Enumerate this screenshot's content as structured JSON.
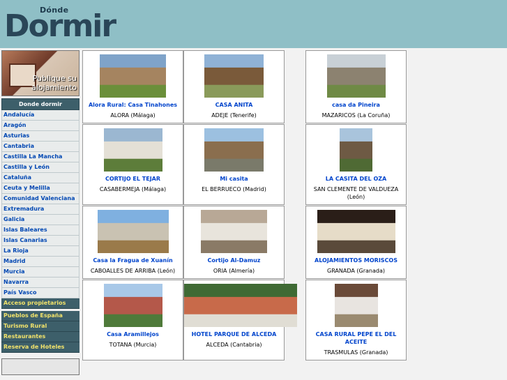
{
  "header": {
    "logo_small": "Dónde",
    "logo_big": "Dormir"
  },
  "sidebar": {
    "promo_text": "Publique su alojamiento",
    "nav_title": "Donde dormir",
    "regions": [
      "Andalucía",
      "Aragón",
      "Asturias",
      "Cantabria",
      "Castilla La Mancha",
      "Castilla y León",
      "Cataluña",
      "Ceuta y Melilla",
      "Comunidad Valenciana",
      "Extremadura",
      "Galicia",
      "Islas Baleares",
      "Islas Canarias",
      "La Rioja",
      "Madrid",
      "Murcia",
      "Navarra",
      "País Vasco"
    ],
    "owner_access": "Acceso propietarios",
    "extra_links": [
      "Pueblos de España",
      "Turismo Rural",
      "Restaurantes",
      "Reserva de Hoteles"
    ]
  },
  "listings": [
    {
      "name": "Alora Rural: Casa Tinahones",
      "location": "ALORA (Málaga)",
      "colors": [
        "#7fa3c9",
        "#a58460",
        "#6b8f3a"
      ]
    },
    {
      "name": "CASA ANITA",
      "location": "ADEJE (Tenerife)",
      "colors": [
        "#8fb2d6",
        "#7a5a3a",
        "#8a9a5a"
      ]
    },
    {
      "name": "casa da Pineira",
      "location": "MAZARICOS (La Coruña)",
      "colors": [
        "#c8d0d6",
        "#8c8270",
        "#6f8a45"
      ]
    },
    {
      "name": "CORTIJO EL TEJAR",
      "location": "CASABERMEJA (Málaga)",
      "colors": [
        "#9bb7d1",
        "#e4e0d6",
        "#5d7d3a"
      ]
    },
    {
      "name": "Mi casita",
      "location": "EL BERRUECO (Madrid)",
      "colors": [
        "#9cc0e0",
        "#8a6e4e",
        "#7a7a6a"
      ]
    },
    {
      "name": "LA CASITA DEL OZA",
      "location": "SAN CLEMENTE DE VALDUEZA (León)",
      "colors": [
        "#a9c4dc",
        "#6e5a44",
        "#4f6a34"
      ]
    },
    {
      "name": "Casa la Fragua de Xuanín",
      "location": "CABOALLES DE ARRIBA (León)",
      "colors": [
        "#7fb0e0",
        "#c9c2b2",
        "#9a7a4a"
      ]
    },
    {
      "name": "Cortijo Al-Damuz",
      "location": "ORIA (Almería)",
      "colors": [
        "#b8a896",
        "#e8e4dc",
        "#8a7a66"
      ]
    },
    {
      "name": "ALOJAMIENTOS MORISCOS",
      "location": "GRANADA (Granada)",
      "colors": [
        "#2a1e18",
        "#e6dcc8",
        "#5a4a3a"
      ]
    },
    {
      "name": "Casa Aramillejos",
      "location": "TOTANA (Murcia)",
      "colors": [
        "#a8c8e8",
        "#b4584a",
        "#4f7a3a"
      ]
    },
    {
      "name": "HOTEL PARQUE DE ALCEDA",
      "location": "ALCEDA (Cantabria)",
      "colors": [
        "#3f6a34",
        "#c86a4a",
        "#e0ddd4"
      ]
    },
    {
      "name": "CASA RURAL PEPE EL DEL ACEITE",
      "location": "TRASMULAS (Granada)",
      "colors": [
        "#6a4a38",
        "#e8e4e0",
        "#9a8a70"
      ]
    }
  ]
}
